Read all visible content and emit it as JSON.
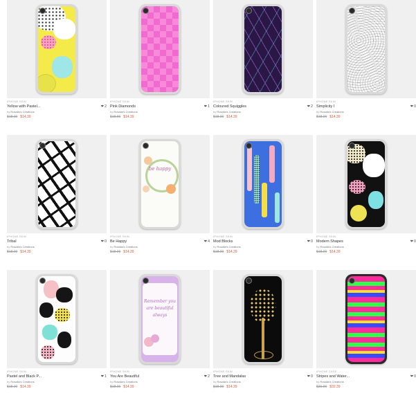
{
  "products": [
    {
      "category": "IPHONE SKIN",
      "title": "Yellow with Pastel...",
      "likes": "2",
      "by": "by",
      "artist": "Rosalia's Creations",
      "old_price": "$18.00",
      "new_price": "$14.39",
      "design": "yellow-pastel"
    },
    {
      "category": "IPHONE SKIN",
      "title": "Pink Diamonds",
      "likes": "1",
      "by": "by",
      "artist": "Rosalia's Creations",
      "old_price": "$18.00",
      "new_price": "$14.39",
      "design": "pink-diamonds"
    },
    {
      "category": "IPHONE SKIN",
      "title": "Coloured Squiggles",
      "likes": "2",
      "by": "by",
      "artist": "Rosalia's Creations",
      "old_price": "$18.00",
      "new_price": "$14.39",
      "design": "squiggles"
    },
    {
      "category": "IPHONE SKIN",
      "title": "Simplicity I",
      "likes": "0",
      "by": "by",
      "artist": "Rosalia's Creations",
      "old_price": "$18.00",
      "new_price": "$14.39",
      "design": "simplicity"
    },
    {
      "category": "IPHONE SKIN",
      "title": "Tribal",
      "likes": "0",
      "by": "by",
      "artist": "Rosalia's Creations",
      "old_price": "$18.00",
      "new_price": "$14.39",
      "design": "tribal"
    },
    {
      "category": "IPHONE SKIN",
      "title": "Be Happy",
      "likes": "4",
      "by": "by",
      "artist": "Rosalia's Creations",
      "old_price": "$18.00",
      "new_price": "$14.39",
      "design": "be-happy",
      "phone_text": "be happy"
    },
    {
      "category": "IPHONE SKIN",
      "title": "Mod Blocks",
      "likes": "0",
      "by": "by",
      "artist": "Rosalia's Creations",
      "old_price": "$18.00",
      "new_price": "$14.39",
      "design": "mod-blocks"
    },
    {
      "category": "IPHONE SKIN",
      "title": "Modern Shapes",
      "likes": "0",
      "by": "by",
      "artist": "Rosalia's Creations",
      "old_price": "$18.00",
      "new_price": "$14.39",
      "design": "modern-shapes"
    },
    {
      "category": "IPHONE SKIN",
      "title": "Pastel and Black P...",
      "likes": "1",
      "by": "by",
      "artist": "Rosalia's Creations",
      "old_price": "$18.00",
      "new_price": "$14.39",
      "design": "pastel-black"
    },
    {
      "category": "IPHONE SKIN",
      "title": "You Are Beautiful",
      "likes": "2",
      "by": "by",
      "artist": "Rosalia's Creations",
      "old_price": "$18.00",
      "new_price": "$14.39",
      "design": "you-are-beautiful",
      "phone_text": "Remember you are beautiful always"
    },
    {
      "category": "IPHONE SKIN",
      "title": "Tree and Mandalas",
      "likes": "0",
      "by": "by",
      "artist": "Rosalia's Creations",
      "old_price": "$18.00",
      "new_price": "$14.39",
      "design": "tree"
    },
    {
      "category": "IPHONE CASE",
      "title": "Stripes and Water...",
      "likes": "0",
      "by": "by",
      "artist": "Rosalia's Creations",
      "old_price": "$36.00",
      "new_price": "$32.39",
      "design": "stripes"
    }
  ],
  "heart_glyph": "❤",
  "colors": {
    "sale_price": "#e05a3c",
    "thumb_bg": "#f0f0f0"
  }
}
